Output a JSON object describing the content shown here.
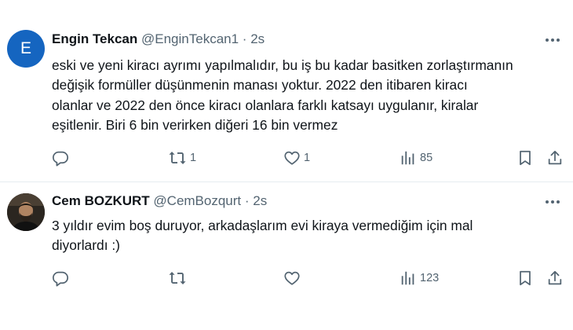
{
  "tweets": [
    {
      "author_name": "Engin Tekcan",
      "handle": "@EnginTekcan1",
      "separator": "·",
      "time": "2s",
      "avatar_letter": "E",
      "avatar_color": "#1565c0",
      "text": "eski ve yeni kiracı ayrımı yapılmalıdır, bu iş bu kadar basitken zorlaştırmanın\ndeğişik formüller düşünmenin manası yoktur. 2022 den itibaren kiracı\nolanlar ve 2022 den önce kiracı olanlara farklı katsayı uygulanır, kiralar\neşitlenir. Biri 6 bin verirken diğeri 16 bin vermez",
      "stats": {
        "replies": "",
        "retweets": "1",
        "likes": "1",
        "views": "85"
      }
    },
    {
      "author_name": "Cem BOZKURT",
      "handle": "@CemBozqurt",
      "separator": "·",
      "time": "2s",
      "text": "3 yıldır evim boş duruyor, arkadaşlarım evi kiraya vermediğim için mal\ndiyorlardı :)",
      "stats": {
        "replies": "",
        "retweets": "",
        "likes": "",
        "views": "123"
      }
    }
  ],
  "colors": {
    "text_primary": "#0f1419",
    "text_secondary": "#536471",
    "divider": "#e6ecf0",
    "background": "#ffffff"
  },
  "icons": [
    "reply-icon",
    "retweet-icon",
    "like-icon",
    "views-icon",
    "bookmark-icon",
    "share-icon",
    "more-icon"
  ]
}
